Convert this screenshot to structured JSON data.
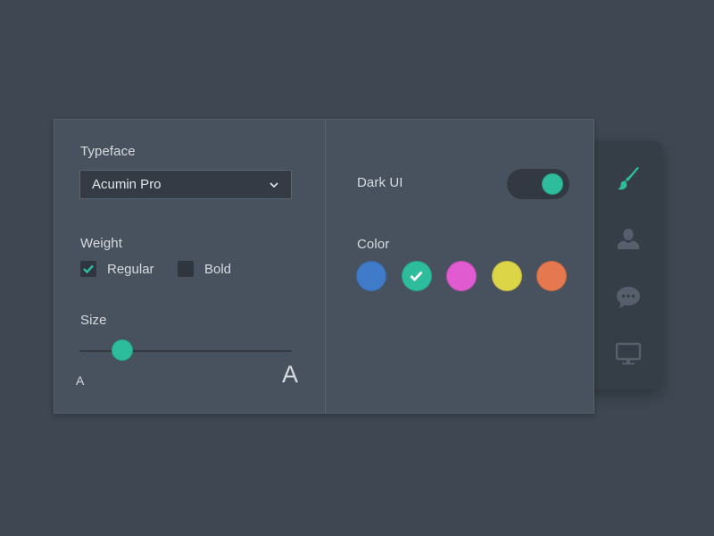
{
  "settings": {
    "typeface": {
      "label": "Typeface",
      "value": "Acumin Pro",
      "chevron_icon": "chevron-down-icon"
    },
    "weight": {
      "label": "Weight",
      "options": [
        {
          "label": "Regular",
          "checked": true
        },
        {
          "label": "Bold",
          "checked": false
        }
      ]
    },
    "size": {
      "label": "Size",
      "min_label": "A",
      "max_label": "A",
      "value": 0.2
    },
    "dark_ui": {
      "label": "Dark UI",
      "on": true
    },
    "color": {
      "label": "Color",
      "selected_index": 1,
      "swatches": [
        {
          "name": "blue",
          "hex": "#3f7bc8"
        },
        {
          "name": "teal",
          "hex": "#2ebd9c"
        },
        {
          "name": "pink",
          "hex": "#e05ad0"
        },
        {
          "name": "yellow",
          "hex": "#ddd548"
        },
        {
          "name": "orange",
          "hex": "#e5784e"
        }
      ]
    }
  },
  "rail": {
    "items": [
      {
        "icon": "paintbrush-icon",
        "active": true
      },
      {
        "icon": "user-icon",
        "active": false
      },
      {
        "icon": "chat-bubble-icon",
        "active": false
      },
      {
        "icon": "monitor-icon",
        "active": false
      }
    ]
  },
  "colors": {
    "background": "#3e4752",
    "panel": "#48525e",
    "accent": "#2ebd9c",
    "icon_muted": "#56606c"
  }
}
